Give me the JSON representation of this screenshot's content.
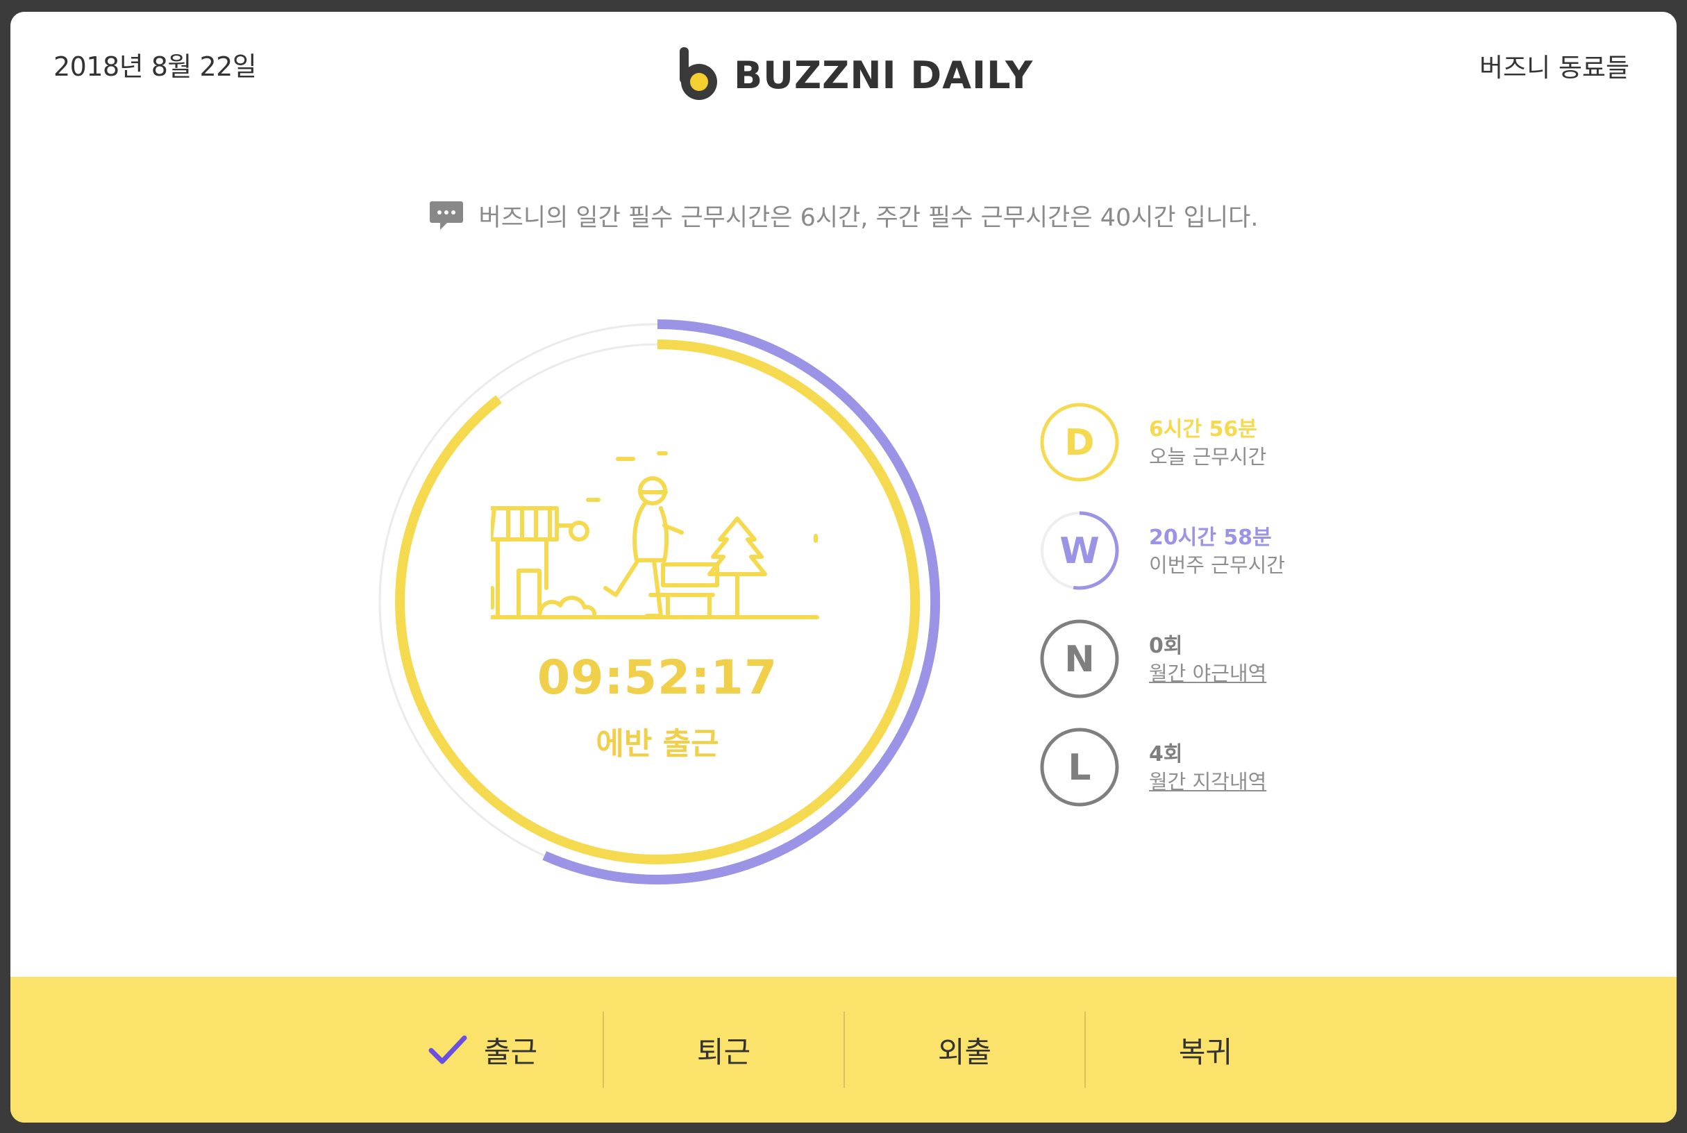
{
  "header": {
    "date": "2018년 8월 22일",
    "logo_text": "BUZZNI DAILY",
    "colleagues_link": "버즈니 동료들"
  },
  "notice": {
    "icon": "speech-bubble-icon",
    "text": "버즈니의 일간 필수 근무시간은 6시간, 주간 필수 근무시간은 40시간 입니다."
  },
  "timer": {
    "clock": "09:52:17",
    "status": "에반 출근"
  },
  "stats": [
    {
      "letter": "D",
      "value": "6시간 56분",
      "label": "오늘 근무시간",
      "color": "#f5d94e"
    },
    {
      "letter": "W",
      "value": "20시간 58분",
      "label": "이번주 근무시간",
      "color": "#9a93e6"
    },
    {
      "letter": "N",
      "value": "0회",
      "label": "월간 야근내역",
      "color": "#7f7f7f"
    },
    {
      "letter": "L",
      "value": "4회",
      "label": "월간 지각내역",
      "color": "#7f7f7f"
    }
  ],
  "actions": [
    {
      "label": "출근",
      "checked": true
    },
    {
      "label": "퇴근",
      "checked": false
    },
    {
      "label": "외출",
      "checked": false
    },
    {
      "label": "복귀",
      "checked": false
    }
  ],
  "colors": {
    "yellow": "#f5d94e",
    "purple": "#9a93e6",
    "bar": "#fbe26b",
    "check": "#6a4fe0"
  }
}
